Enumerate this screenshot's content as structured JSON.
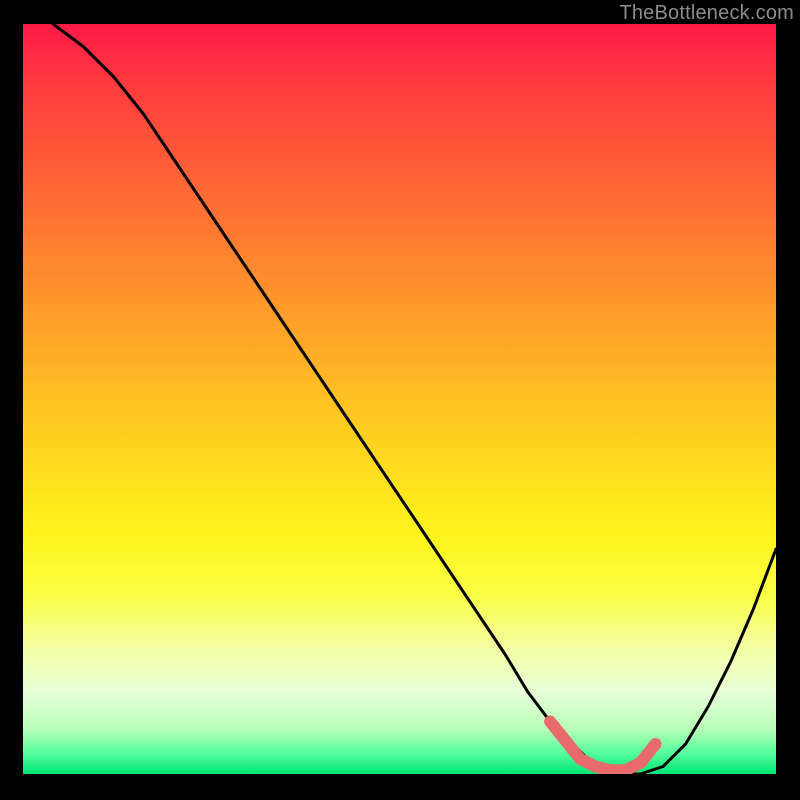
{
  "watermark": "TheBottleneck.com",
  "colors": {
    "curve": "#000000",
    "highlight": "#e96a6a",
    "background_top": "#ff1a47",
    "background_bottom": "#00e676",
    "frame": "#000000"
  },
  "chart_data": {
    "type": "line",
    "title": "",
    "xlabel": "",
    "ylabel": "",
    "xlim": [
      0,
      100
    ],
    "ylim": [
      0,
      100
    ],
    "grid": false,
    "series": [
      {
        "name": "bottleneck-curve",
        "x": [
          4,
          8,
          12,
          16,
          20,
          24,
          28,
          32,
          36,
          40,
          44,
          48,
          52,
          56,
          60,
          64,
          67,
          70,
          73,
          76,
          79,
          82,
          85,
          88,
          91,
          94,
          97,
          100
        ],
        "values": [
          100,
          97,
          93,
          88,
          82,
          76,
          70,
          64,
          58,
          52,
          46,
          40,
          34,
          28,
          22,
          16,
          11,
          7,
          4,
          1,
          0,
          0,
          1,
          4,
          9,
          15,
          22,
          30
        ]
      }
    ],
    "annotations": [
      {
        "name": "flat-bottom-highlight",
        "x": [
          70,
          72,
          74,
          76,
          78,
          80,
          82,
          84
        ],
        "values": [
          7,
          4.5,
          2,
          1,
          0.5,
          0.5,
          1.5,
          4
        ]
      }
    ]
  }
}
